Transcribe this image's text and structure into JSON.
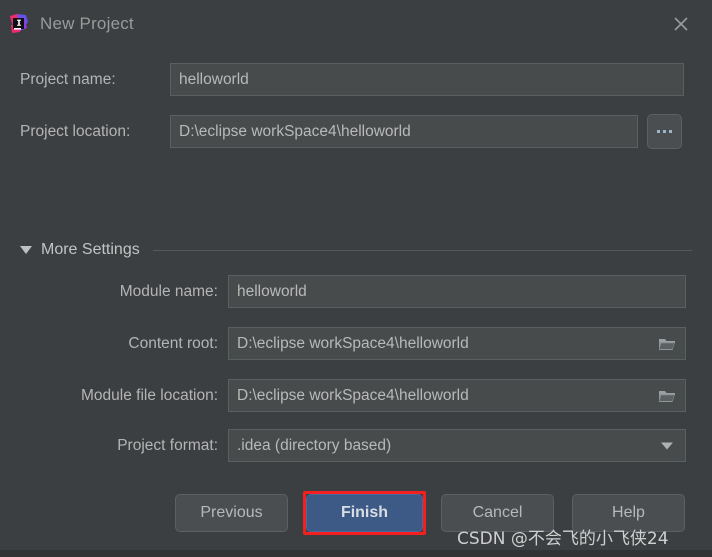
{
  "window": {
    "title": "New Project",
    "app_icon": "intellij-idea-logo",
    "close_icon": "close-icon",
    "background_color": "#3c3f41",
    "accent_color": "#3d5a86",
    "highlight_color": "#f42020"
  },
  "form": {
    "project_name": {
      "label": "Project name:",
      "value": "helloworld",
      "placeholder": ""
    },
    "project_location": {
      "label": "Project location:",
      "value": "D:\\eclipse workSpace4\\helloworld",
      "placeholder": "",
      "browse_label": "...",
      "browse_icon": "ellipsis-icon"
    }
  },
  "more_settings": {
    "label": "More Settings",
    "expanded": true,
    "toggle_icon": "chevron-down-icon",
    "fields": [
      {
        "name": "module-name",
        "label": "Module name:",
        "value": "helloworld",
        "type": "text",
        "trailing_icon": ""
      },
      {
        "name": "content-root",
        "label": "Content root:",
        "value": "D:\\eclipse workSpace4\\helloworld",
        "type": "text",
        "trailing_icon": "folder-icon"
      },
      {
        "name": "module-file-location",
        "label": "Module file location:",
        "value": "D:\\eclipse workSpace4\\helloworld",
        "type": "text",
        "trailing_icon": "folder-icon"
      },
      {
        "name": "project-format",
        "label": "Project format:",
        "value": ".idea (directory based)",
        "type": "select",
        "trailing_icon": "chevron-down-icon"
      }
    ]
  },
  "buttons": {
    "previous": "Previous",
    "finish": "Finish",
    "cancel": "Cancel",
    "help": "Help"
  },
  "watermark": {
    "text": "CSDN @不会飞的小飞侠24"
  }
}
